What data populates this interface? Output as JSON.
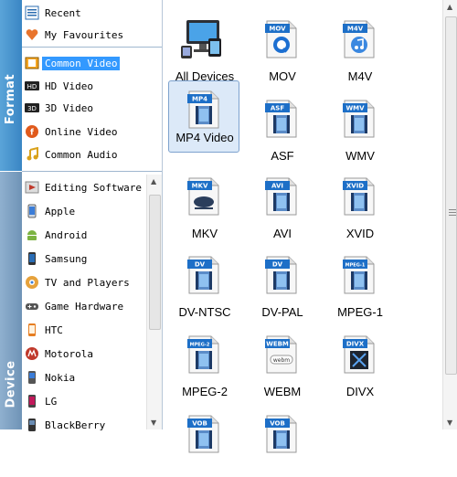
{
  "tabs": {
    "format": "Format",
    "device": "Device"
  },
  "format_categories": [
    {
      "label": "Recent",
      "icon": "recent-icon",
      "color": "#2b6cb0"
    },
    {
      "label": "My Favourites",
      "icon": "heart-icon",
      "color": "#e8742c"
    },
    {
      "label": "Common Video",
      "icon": "film-icon",
      "selected": true,
      "color": "#3399ff"
    },
    {
      "label": "HD Video",
      "icon": "hd-icon",
      "color": "#333333"
    },
    {
      "label": "3D Video",
      "icon": "3d-icon",
      "color": "#333333"
    },
    {
      "label": "Online Video",
      "icon": "online-video-icon",
      "color": "#e05a1c"
    },
    {
      "label": "Common Audio",
      "icon": "music-note-icon",
      "color": "#d9a21b"
    }
  ],
  "device_categories": [
    {
      "label": "Editing Software",
      "icon": "editing-software-icon",
      "color": "#c0392b"
    },
    {
      "label": "Apple",
      "icon": "apple-icon",
      "color": "#3b7dd8"
    },
    {
      "label": "Android",
      "icon": "android-icon",
      "color": "#7cb342"
    },
    {
      "label": "Samsung",
      "icon": "samsung-icon",
      "color": "#2a6db5"
    },
    {
      "label": "TV and Players",
      "icon": "tv-icon",
      "color": "#e6a23c"
    },
    {
      "label": "Game Hardware",
      "icon": "game-icon",
      "color": "#555555"
    },
    {
      "label": "HTC",
      "icon": "htc-icon",
      "color": "#e67e22"
    },
    {
      "label": "Motorola",
      "icon": "motorola-icon",
      "color": "#c0392b"
    },
    {
      "label": "Nokia",
      "icon": "nokia-icon",
      "color": "#3b7dd8"
    },
    {
      "label": "LG",
      "icon": "lg-icon",
      "color": "#c2185b"
    },
    {
      "label": "BlackBerry",
      "icon": "blackberry-icon",
      "color": "#333333"
    }
  ],
  "formats": [
    {
      "label": "All Devices",
      "badge": "",
      "icon": "devices-icon"
    },
    {
      "label": "MOV",
      "badge": "MOV",
      "icon": "quicktime-icon"
    },
    {
      "label": "M4V",
      "badge": "M4V",
      "icon": "itunes-icon"
    },
    {
      "label": "MP4 Video",
      "badge": "MP4",
      "icon": "film-file-icon",
      "selected": true
    },
    {
      "label": "ASF",
      "badge": "ASF",
      "icon": "film-file-icon"
    },
    {
      "label": "WMV",
      "badge": "WMV",
      "icon": "film-file-icon"
    },
    {
      "label": "MKV",
      "badge": "MKV",
      "icon": "matroska-icon"
    },
    {
      "label": "AVI",
      "badge": "AVI",
      "icon": "film-file-icon"
    },
    {
      "label": "XVID",
      "badge": "XVID",
      "icon": "film-file-icon"
    },
    {
      "label": "DV-NTSC",
      "badge": "DV",
      "icon": "film-file-icon"
    },
    {
      "label": "DV-PAL",
      "badge": "DV",
      "icon": "film-file-icon"
    },
    {
      "label": "MPEG-1",
      "badge": "MPEG-1",
      "icon": "film-file-icon"
    },
    {
      "label": "MPEG-2",
      "badge": "MPEG-2",
      "icon": "film-file-icon"
    },
    {
      "label": "WEBM",
      "badge": "WEBM",
      "icon": "webm-icon"
    },
    {
      "label": "DIVX",
      "badge": "DIVX",
      "icon": "divx-icon"
    },
    {
      "label": "",
      "badge": "VOB",
      "icon": "film-file-icon"
    },
    {
      "label": "",
      "badge": "VOB",
      "icon": "film-file-icon"
    }
  ],
  "colors": {
    "accent": "#3399ff",
    "badge": "#1d6fc7",
    "tab_format": "#3a86c4",
    "tab_device": "#7597b8"
  }
}
